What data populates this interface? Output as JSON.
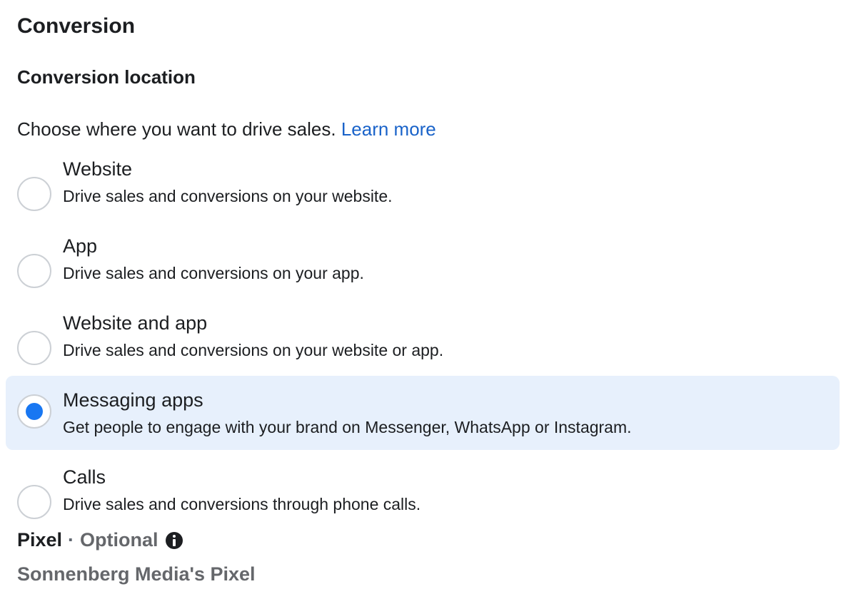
{
  "section": {
    "title": "Conversion"
  },
  "conversion_location": {
    "title": "Conversion location",
    "intro": "Choose where you want to drive sales.",
    "learn_more": "Learn more",
    "options": [
      {
        "label": "Website",
        "description": "Drive sales and conversions on your website.",
        "selected": false
      },
      {
        "label": "App",
        "description": "Drive sales and conversions on your app.",
        "selected": false
      },
      {
        "label": "Website and app",
        "description": "Drive sales and conversions on your website or app.",
        "selected": false
      },
      {
        "label": "Messaging apps",
        "description": "Get people to engage with your brand on Messenger, WhatsApp or Instagram.",
        "selected": true
      },
      {
        "label": "Calls",
        "description": "Drive sales and conversions through phone calls.",
        "selected": false
      }
    ]
  },
  "pixel": {
    "label": "Pixel",
    "separator": "·",
    "optional": "Optional",
    "info_icon": "info-icon",
    "name": "Sonnenberg Media's Pixel"
  },
  "colors": {
    "accent": "#1877f2",
    "link": "#1a63c9",
    "selected_bg": "#e7f0fc",
    "muted_text": "#65676b"
  }
}
